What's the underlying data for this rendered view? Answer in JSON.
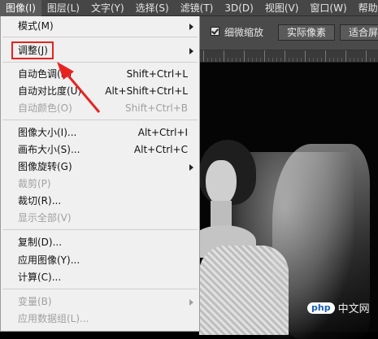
{
  "menubar": {
    "items": [
      "图像(I)",
      "图层(L)",
      "文字(Y)",
      "选择(S)",
      "滤镜(T)",
      "3D(D)",
      "视图(V)",
      "窗口(W)",
      "帮助"
    ]
  },
  "options": {
    "checkbox_label": "细微缩放",
    "button_actual_pixels": "实际像素",
    "button_fit": "适合屏"
  },
  "menu": {
    "mode": "模式(M)",
    "adjust": "调整(J)",
    "auto_tone": "自动色调(N)",
    "auto_tone_sc": "Shift+Ctrl+L",
    "auto_contrast": "自动对比度(U)",
    "auto_contrast_sc": "Alt+Shift+Ctrl+L",
    "auto_color": "自动颜色(O)",
    "auto_color_sc": "Shift+Ctrl+B",
    "image_size": "图像大小(I)...",
    "image_size_sc": "Alt+Ctrl+I",
    "canvas_size": "画布大小(S)...",
    "canvas_size_sc": "Alt+Ctrl+C",
    "image_rotation": "图像旋转(G)",
    "crop": "裁剪(P)",
    "trim": "裁切(R)...",
    "reveal_all": "显示全部(V)",
    "duplicate": "复制(D)...",
    "apply_image": "应用图像(Y)...",
    "calculations": "计算(C)...",
    "variables": "变量(B)",
    "apply_data_set": "应用数据组(L)..."
  },
  "watermark": {
    "logo": "php",
    "text": "中文网"
  },
  "colors": {
    "highlight": "#e8231f"
  }
}
